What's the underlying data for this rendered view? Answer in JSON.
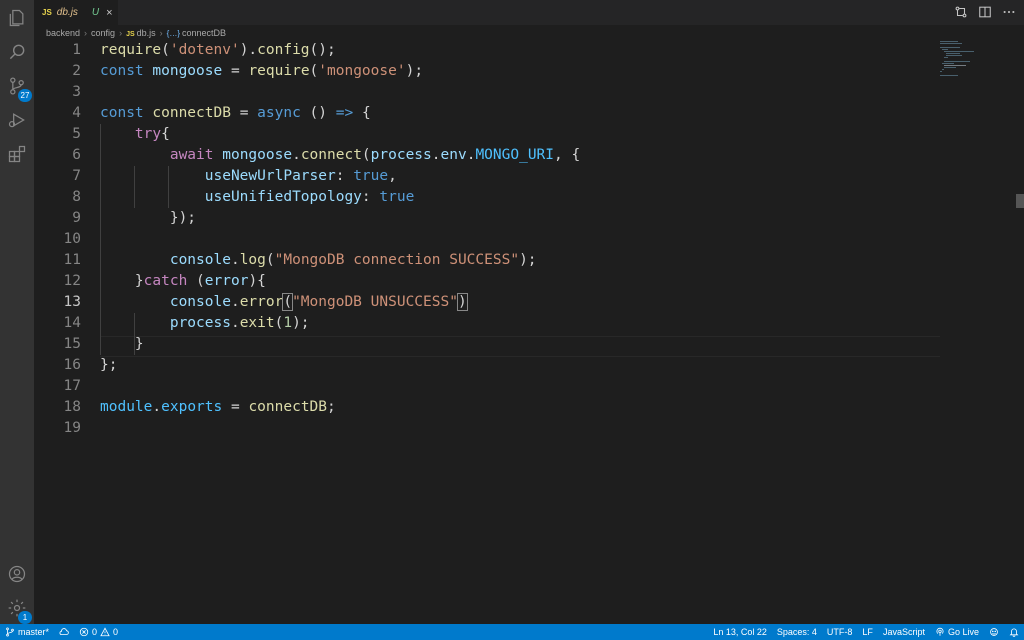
{
  "tab": {
    "name": "db.js",
    "status": "U",
    "lang_badge": "JS"
  },
  "activity": {
    "scm_badge": "27",
    "settings_badge": "1"
  },
  "breadcrumb": {
    "items": [
      "backend",
      "config",
      "db.js",
      "connectDB"
    ],
    "file_badge": "JS",
    "symbol_icon": "{…}"
  },
  "editor": {
    "active_line": 13,
    "line_numbers": [
      "1",
      "2",
      "3",
      "4",
      "5",
      "6",
      "7",
      "8",
      "9",
      "10",
      "11",
      "12",
      "13",
      "14",
      "15",
      "16",
      "17",
      "18",
      "19"
    ]
  },
  "status": {
    "branch": "master*",
    "errors": "0",
    "warnings": "0",
    "position": "Ln 13, Col 22",
    "spaces": "Spaces: 4",
    "encoding": "UTF-8",
    "eol": "LF",
    "language": "JavaScript",
    "go_live": "Go Live"
  },
  "colors": {
    "status_bar": "#007acc",
    "editor_bg": "#1e1e1e",
    "activity_bar": "#333333"
  }
}
